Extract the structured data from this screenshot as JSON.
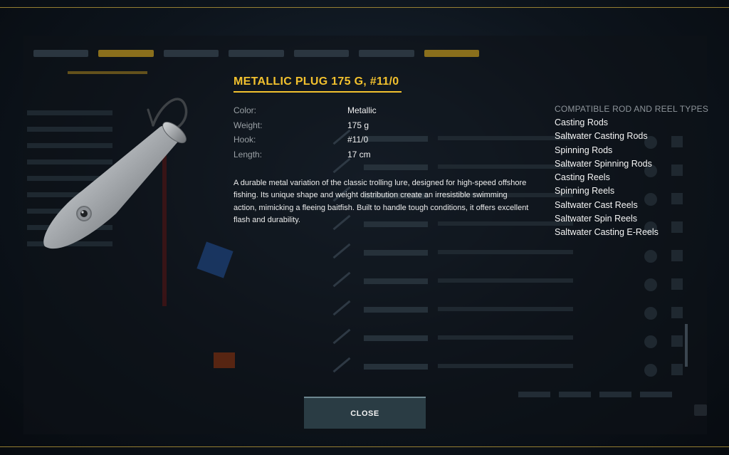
{
  "item": {
    "title": "METALLIC PLUG 175 G, #11/0",
    "properties": [
      {
        "label": "Color:",
        "value": "Metallic"
      },
      {
        "label": "Weight:",
        "value": "175 g"
      },
      {
        "label": "Hook:",
        "value": "#11/0"
      },
      {
        "label": "Length:",
        "value": "17 cm"
      }
    ],
    "description": "A durable metal variation of the classic trolling lure, designed for high-speed offshore fishing. Its unique shape and weight distribution create an irresistible swimming action, mimicking a fleeing baitfish. Built to handle tough conditions, it offers excellent flash and durability."
  },
  "compatible": {
    "title": "COMPATIBLE ROD AND REEL TYPES",
    "items": [
      "Casting Rods",
      "Saltwater Casting Rods",
      "Spinning Rods",
      "Saltwater Spinning Rods",
      "Casting Reels",
      "Spinning Reels",
      "Saltwater Cast Reels",
      "Saltwater Spin Reels",
      "Saltwater Casting E-Reels"
    ]
  },
  "close_button": {
    "label": "CLOSE"
  },
  "colors": {
    "accent": "#f2c12e",
    "button_bg": "#2a3c44",
    "label_gray": "#9aa0a5"
  },
  "icons": {
    "lure": "metallic-plug-lure-image"
  }
}
